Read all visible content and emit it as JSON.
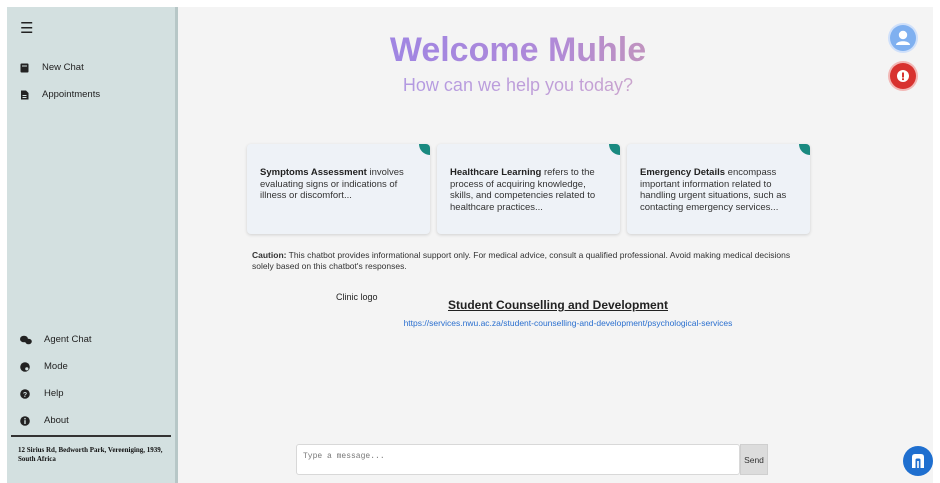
{
  "sidebar": {
    "menu_icon": "menu-icon",
    "top_items": [
      {
        "label": "New Chat",
        "icon": "chat-book-icon"
      },
      {
        "label": "Appointments",
        "icon": "document-icon"
      }
    ],
    "bottom_items": [
      {
        "label": "Agent Chat",
        "icon": "agent-chat-icon"
      },
      {
        "label": "Mode",
        "icon": "palette-icon"
      },
      {
        "label": "Help",
        "icon": "help-icon"
      },
      {
        "label": "About",
        "icon": "info-icon"
      }
    ],
    "address": "12 Sirius Rd, Bedworth Park, Vereeniging, 1939, South Africa"
  },
  "header": {
    "welcome": "Welcome Muhle",
    "subtitle": "How can we help you today?"
  },
  "cards": [
    {
      "title": "Symptoms Assessment",
      "body": " involves evaluating signs or indications of illness or discomfort..."
    },
    {
      "title": "Healthcare Learning",
      "body": " refers to the process of acquiring knowledge, skills, and competencies related to healthcare practices..."
    },
    {
      "title": "Emergency Details",
      "body": " encompass important information related to handling urgent situations, such as contacting emergency services..."
    }
  ],
  "caution": {
    "label": "Caution:",
    "text": " This chatbot provides informational support only. For medical advice, consult a qualified professional. Avoid making medical decisions solely based on this chatbot's responses."
  },
  "clinic": {
    "logo_alt": "Clinic logo",
    "title": "Student Counselling and Development",
    "link": "https://services.nwu.ac.za/student-counselling-and-development/psychological-services"
  },
  "composer": {
    "placeholder": "Type a message...",
    "send_label": "Send"
  },
  "colors": {
    "sidebar_bg": "#d3e0e0",
    "accent_teal": "#1a8a80",
    "alert_red": "#d8322f",
    "link_blue": "#2a6fcf",
    "fab_blue": "#1f6fcf"
  }
}
